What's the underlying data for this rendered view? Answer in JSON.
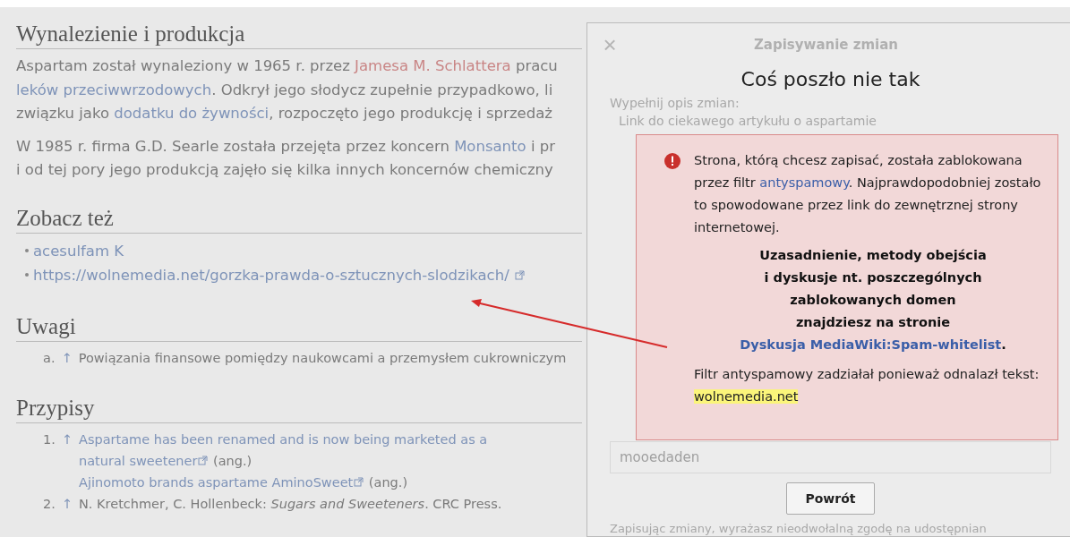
{
  "article": {
    "sections": [
      {
        "heading": "Wynalezienie i produkcja",
        "kind": "paragraphs",
        "paragraphs": [
          [
            [
              {
                "t": "Aspartam został wynaleziony w 1965 r. przez ",
                "kind": "plain"
              },
              {
                "t": "Jamesa M. Schlattera",
                "kind": "redlink"
              },
              {
                "t": " pracu",
                "kind": "plain"
              }
            ],
            [
              {
                "t": "leków przeciwwrzodowych",
                "kind": "link"
              },
              {
                "t": ". Odkrył jego słodycz zupełnie przypadkowo, li",
                "kind": "plain"
              }
            ],
            [
              {
                "t": "związku jako ",
                "kind": "plain"
              },
              {
                "t": "dodatku do żywności",
                "kind": "link"
              },
              {
                "t": ", rozpoczęto jego produkcję i sprzedaż",
                "kind": "plain"
              }
            ]
          ],
          [
            [
              {
                "t": "W 1985 r. firma G.D. Searle została przejęta przez koncern ",
                "kind": "plain"
              },
              {
                "t": "Monsanto",
                "kind": "link"
              },
              {
                "t": " i pr",
                "kind": "plain"
              }
            ],
            [
              {
                "t": "i od tej pory jego produkcją zajęło się kilka innych koncernów chemiczny",
                "kind": "plain"
              }
            ]
          ]
        ]
      },
      {
        "heading": "Zobacz też",
        "kind": "bullets",
        "items": [
          "acesulfam K",
          "https://wolnemedia.net/gorzka-prawda-o-sztucznych-slodzikach/"
        ]
      },
      {
        "heading": "Uwagi",
        "kind": "notes",
        "items": [
          {
            "marker": "a.",
            "arrow": "↑",
            "text": "Powiązania finansowe pomiędzy naukowcami a przemysłem cukrowniczym"
          }
        ]
      },
      {
        "heading": "Przypisy",
        "kind": "refs",
        "items": [
          {
            "marker": "1.",
            "arrow": "↑",
            "lines": [
              [
                {
                  "t": "Aspartame has been renamed and is now being marketed as a",
                  "kind": "link"
                }
              ],
              [
                {
                  "t": "natural sweetener",
                  "kind": "extlink"
                },
                {
                  "t": " (ang.)",
                  "kind": "plain"
                }
              ],
              [
                {
                  "t": "Ajinomoto brands aspartame AminoSweet",
                  "kind": "extlink"
                },
                {
                  "t": " (ang.)",
                  "kind": "plain"
                }
              ]
            ]
          },
          {
            "marker": "2.",
            "arrow": "↑",
            "lines": [
              [
                {
                  "t": "N. Kretchmer, C. Hollenbeck: ",
                  "kind": "plain"
                },
                {
                  "t": "Sugars and Sweeteners",
                  "kind": "italic"
                },
                {
                  "t": ". CRC Press.",
                  "kind": "plain"
                }
              ]
            ]
          }
        ]
      }
    ]
  },
  "dialog": {
    "close": "×",
    "title": "Zapisywanie zmian",
    "summary_label": "Wypełnij opis zmian:",
    "summary_value": "Link do ciekawego artykułu o aspartamie",
    "captcha_value": "mooedaden",
    "footer": "Zapisując zmiany, wyrażasz nieodwołalną zgodę na udostępnian",
    "error": {
      "title": "Coś poszło nie tak",
      "message": [
        {
          "t": "Strona, którą chcesz zapisać, została zablokowana przez filtr ",
          "kind": "plain"
        },
        {
          "t": "antyspamowy",
          "kind": "link"
        },
        {
          "t": ". Najprawdopodobniej zostało to spowodowane przez link do zewnętrznej strony internetowej.",
          "kind": "plain"
        }
      ],
      "note": [
        {
          "t": "Uzasadnienie, metody obejścia",
          "kind": "plain"
        },
        {
          "t": "i dyskusje nt. poszczególnych",
          "kind": "plain"
        },
        {
          "t": "zablokowanych domen",
          "kind": "plain"
        },
        {
          "t": "znajdziesz na stronie",
          "kind": "plain"
        },
        {
          "t": "Dyskusja MediaWiki:Spam-whitelist",
          "kind": "link"
        }
      ],
      "note_end": ".",
      "match_text": "Filtr antyspamowy zadziałał ponieważ odnalazł tekst:",
      "match": "wolnemedia.net",
      "button": "Powrót"
    }
  }
}
